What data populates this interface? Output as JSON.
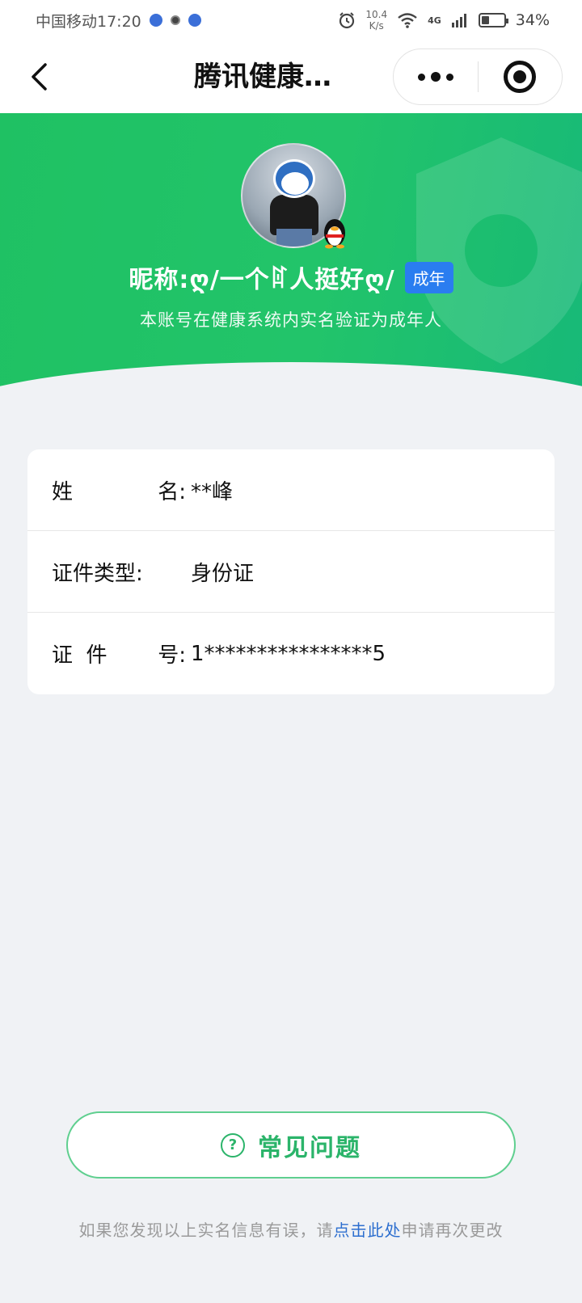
{
  "status_bar": {
    "carrier_time": "中国移动17:20",
    "net_speed_value": "10.4",
    "net_speed_unit": "K/s",
    "network_type": "4G",
    "battery": "34%",
    "battery_level": 0.34
  },
  "nav": {
    "title": "腾讯健康…"
  },
  "hero": {
    "nickname": "昵称:ღ/一个ꍏ人挺好ღ/",
    "badge": "成年",
    "verify_text": "本账号在健康系统内实名验证为成年人"
  },
  "info": {
    "rows": [
      {
        "label_a": "姓",
        "label_b": "名:",
        "value": "**峰"
      },
      {
        "label_a": "证件类型:",
        "label_b": "",
        "value": "身份证"
      },
      {
        "label_a": "证  件",
        "label_b": "号:",
        "value": "1****************5"
      }
    ]
  },
  "faq": {
    "label": "常见问题",
    "icon": "question-circle-icon"
  },
  "footer": {
    "prefix": "如果您发现以上实名信息有误，请",
    "link": "点击此处",
    "suffix": "申请再次更改"
  },
  "colors": {
    "brand_green": "#22c46a",
    "badge_blue": "#2a7df0",
    "link_blue": "#2d6fcf"
  }
}
